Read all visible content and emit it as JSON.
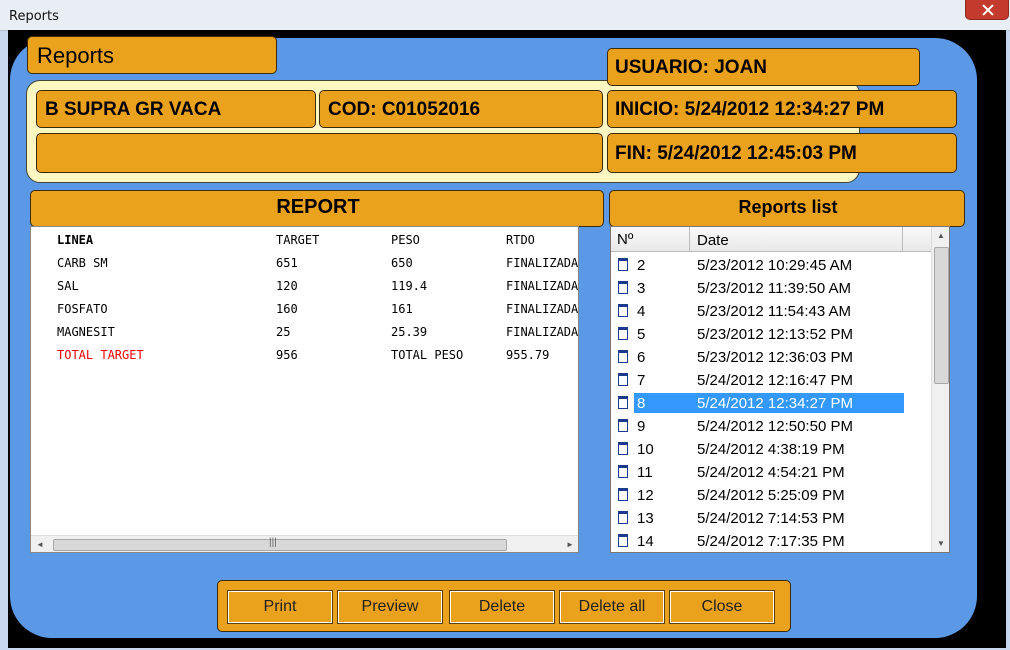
{
  "window": {
    "title": "Reports"
  },
  "header": {
    "reports_title": "Reports",
    "usuario": "USUARIO: JOAN",
    "product": "B SUPRA GR VACA",
    "cod": "COD: C01052016",
    "extra": "",
    "inicio": "INICIO: 5/24/2012 12:34:27 PM",
    "fin": "FIN: 5/24/2012 12:45:03 PM"
  },
  "report": {
    "heading": "REPORT",
    "columns": [
      "LINEA",
      "TARGET",
      "PESO",
      "RTDO"
    ],
    "rows": [
      [
        "CARB SM",
        "651",
        "650",
        "FINALIZADA"
      ],
      [
        "SAL",
        "120",
        "119.4",
        "FINALIZADA"
      ],
      [
        "FOSFATO",
        "160",
        "161",
        "FINALIZADA"
      ],
      [
        "MAGNESIT",
        "25",
        "25.39",
        "FINALIZADA"
      ]
    ],
    "total": [
      "TOTAL TARGET",
      "956",
      "TOTAL PESO",
      "955.79"
    ],
    "colors": {
      "total_label": "#e00000"
    }
  },
  "reports_list": {
    "heading": "Reports list",
    "col_no": "Nº",
    "col_date": "Date",
    "items": [
      {
        "no": "2",
        "date": "5/23/2012 10:29:45 AM"
      },
      {
        "no": "3",
        "date": "5/23/2012 11:39:50 AM"
      },
      {
        "no": "4",
        "date": "5/23/2012 11:54:43 AM"
      },
      {
        "no": "5",
        "date": "5/23/2012 12:13:52 PM"
      },
      {
        "no": "6",
        "date": "5/23/2012 12:36:03 PM"
      },
      {
        "no": "7",
        "date": "5/24/2012 12:16:47 PM"
      },
      {
        "no": "8",
        "date": "5/24/2012 12:34:27 PM"
      },
      {
        "no": "9",
        "date": "5/24/2012 12:50:50 PM"
      },
      {
        "no": "10",
        "date": "5/24/2012 4:38:19 PM"
      },
      {
        "no": "11",
        "date": "5/24/2012 4:54:21 PM"
      },
      {
        "no": "12",
        "date": "5/24/2012 5:25:09 PM"
      },
      {
        "no": "13",
        "date": "5/24/2012 7:14:53 PM"
      },
      {
        "no": "14",
        "date": "5/24/2012 7:17:35 PM"
      }
    ],
    "selected_no": "8",
    "icon": "document-icon"
  },
  "buttons": {
    "print": "Print",
    "preview": "Preview",
    "delete": "Delete",
    "delete_all": "Delete all",
    "close": "Close"
  },
  "colors": {
    "accent": "#eaa21d",
    "background": "#5b98e6",
    "panel": "#fdf8c2",
    "selection": "#3399ff"
  }
}
